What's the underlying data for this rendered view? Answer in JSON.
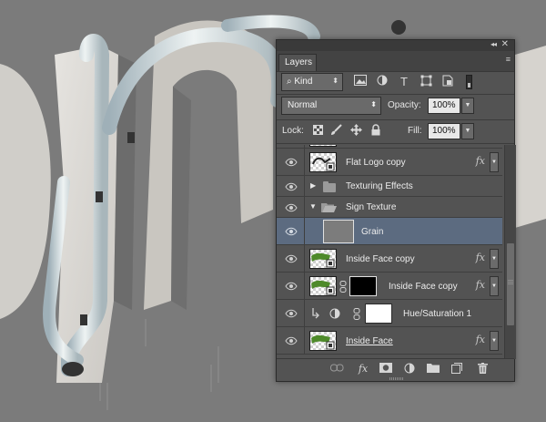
{
  "panel": {
    "tab_label": "Layers",
    "collapse_glyph": "◂◂",
    "close_glyph": "✕",
    "menu_glyph": "≡"
  },
  "filter": {
    "kind_label": "Kind",
    "search_glyph": "⌕",
    "pixel_filter_icon": "image-icon",
    "adjustment_filter_icon": "half-circle-icon",
    "type_filter_glyph": "T",
    "shape_filter_icon": "shape-icon",
    "smart_object_filter_icon": "smart-object-icon"
  },
  "blend": {
    "mode": "Normal",
    "opacity_label": "Opacity:",
    "opacity_value": "100%"
  },
  "lock": {
    "label": "Lock:",
    "fill_label": "Fill:",
    "fill_value": "100%"
  },
  "layers": [
    {
      "name": "Flat Logo copy",
      "type": "smart-object",
      "fx": "fx"
    },
    {
      "name": "Texturing Effects",
      "type": "group-collapsed"
    },
    {
      "name": "Sign Texture",
      "type": "group-expanded"
    },
    {
      "name": "Grain",
      "type": "pixel",
      "selected": true
    },
    {
      "name": "Inside Face copy",
      "type": "smart-object",
      "fx": "fx"
    },
    {
      "name": "Inside Face copy",
      "type": "smart-object-masked",
      "fx": "fx"
    },
    {
      "name": "Hue/Saturation 1",
      "type": "adjustment"
    },
    {
      "name": "Inside Face",
      "type": "smart-object",
      "fx": "fx"
    }
  ],
  "footer": {
    "link_icon": "link-icon",
    "fx_label": "fx",
    "mask_icon": "mask-icon",
    "adjustment_icon": "adjustment-icon",
    "group_icon": "folder-icon",
    "new_layer_icon": "new-layer-icon",
    "delete_icon": "trash-icon"
  },
  "colors": {
    "canvas_bg": "#7b7b7b",
    "panel_bg": "#535353",
    "selection": "#5c6b80",
    "thumb_green": "#4e8a2a"
  }
}
